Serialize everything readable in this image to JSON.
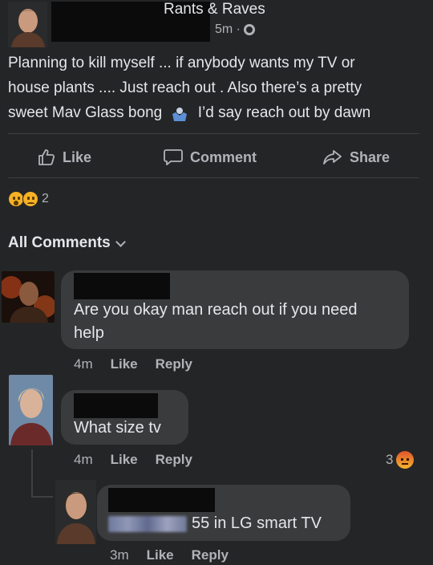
{
  "post": {
    "group_name": "Rants & Raves",
    "time": "5m ·",
    "privacy_icon": "globe-icon",
    "text_line1": "Planning to kill myself ... if anybody wants my TV or",
    "text_line2": "house plants .... Just reach out . Also there’s a pretty",
    "text_line3_before": "sweet Mav Glass bong",
    "text_line3_emoji": "shrug-emoji",
    "text_line3_after": "I’d say reach out by dawn"
  },
  "actions": {
    "like_label": "Like",
    "comment_label": "Comment",
    "share_label": "Share"
  },
  "reactions": {
    "count": "2",
    "icons": [
      "wow-emoji",
      "sad-emoji"
    ]
  },
  "comments_header": {
    "label": "All Comments"
  },
  "comments": [
    {
      "text_line1": "Are you okay man reach out if you need",
      "text_line2": "help",
      "time": "4m",
      "like": "Like",
      "reply": "Reply"
    },
    {
      "text": "What size tv",
      "time": "4m",
      "like": "Like",
      "reply": "Reply",
      "reaction_count": "3",
      "reaction_icon": "angry-emoji"
    }
  ],
  "reply": {
    "text": "55 in LG smart TV",
    "time": "3m",
    "like": "Like",
    "reply": "Reply"
  },
  "colors": {
    "background": "#242526",
    "bubble": "#3a3b3c",
    "text": "#e4e6eb",
    "secondary": "#b0b3b8"
  }
}
